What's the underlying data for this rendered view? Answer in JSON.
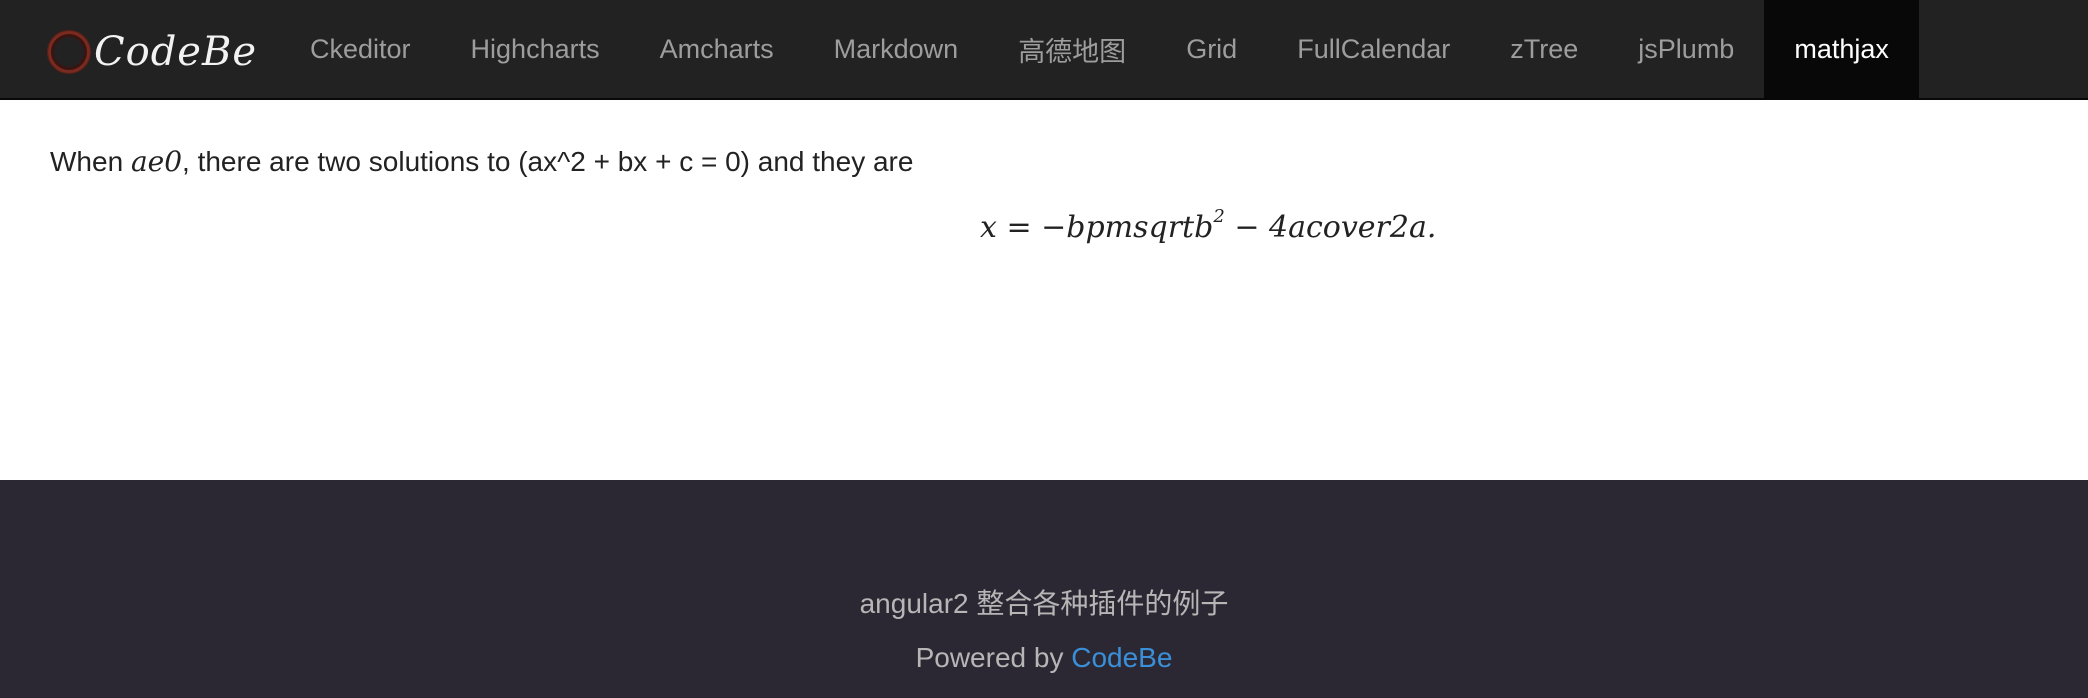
{
  "brand": {
    "name": "CodeBe"
  },
  "nav": {
    "items": [
      {
        "label": "Ckeditor",
        "active": false
      },
      {
        "label": "Highcharts",
        "active": false
      },
      {
        "label": "Amcharts",
        "active": false
      },
      {
        "label": "Markdown",
        "active": false
      },
      {
        "label": "高德地图",
        "active": false
      },
      {
        "label": "Grid",
        "active": false
      },
      {
        "label": "FullCalendar",
        "active": false
      },
      {
        "label": "zTree",
        "active": false
      },
      {
        "label": "jsPlumb",
        "active": false
      },
      {
        "label": "mathjax",
        "active": true
      }
    ]
  },
  "content": {
    "intro_before": "When ",
    "intro_math": "ae0",
    "intro_after": ", there are two solutions to (ax^2 + bx + c = 0) and they are",
    "formula_main": "x = −bpmsqrtb",
    "formula_sup": "2",
    "formula_rest": " − 4acover2a."
  },
  "footer": {
    "tagline": "angular2 整合各种插件的例子",
    "powered_prefix": "Powered by ",
    "powered_link": "CodeBe"
  },
  "colors": {
    "navbar_bg": "#222222",
    "nav_active_bg": "#080808",
    "footer_bg": "#2b2833",
    "link": "#3a8fd8"
  }
}
